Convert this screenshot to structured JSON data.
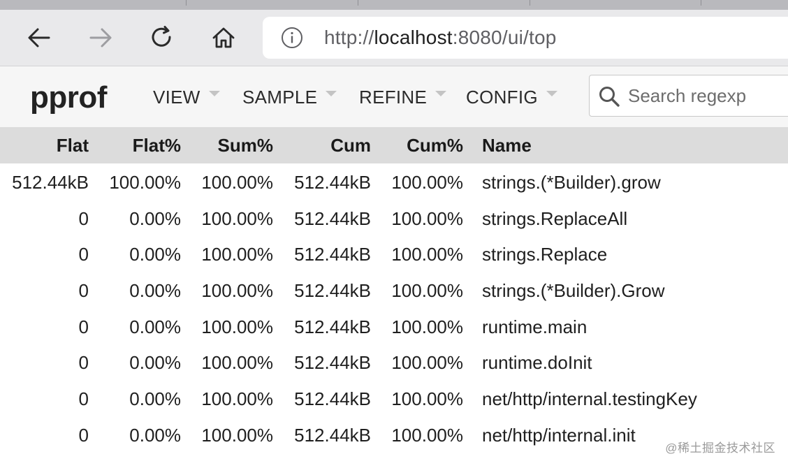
{
  "browser": {
    "url_scheme": "http://",
    "url_host": "localhost",
    "url_rest": ":8080/ui/top"
  },
  "app": {
    "title": "pprof",
    "menus": [
      {
        "label": "VIEW"
      },
      {
        "label": "SAMPLE"
      },
      {
        "label": "REFINE"
      },
      {
        "label": "CONFIG"
      }
    ],
    "search": {
      "placeholder": "Search regexp",
      "value": ""
    }
  },
  "table": {
    "columns": [
      "Flat",
      "Flat%",
      "Sum%",
      "Cum",
      "Cum%",
      "Name"
    ],
    "rows": [
      {
        "flat": "512.44kB",
        "flat_pct": "100.00%",
        "sum_pct": "100.00%",
        "cum": "512.44kB",
        "cum_pct": "100.00%",
        "name": "strings.(*Builder).grow"
      },
      {
        "flat": "0",
        "flat_pct": "0.00%",
        "sum_pct": "100.00%",
        "cum": "512.44kB",
        "cum_pct": "100.00%",
        "name": "strings.ReplaceAll"
      },
      {
        "flat": "0",
        "flat_pct": "0.00%",
        "sum_pct": "100.00%",
        "cum": "512.44kB",
        "cum_pct": "100.00%",
        "name": "strings.Replace"
      },
      {
        "flat": "0",
        "flat_pct": "0.00%",
        "sum_pct": "100.00%",
        "cum": "512.44kB",
        "cum_pct": "100.00%",
        "name": "strings.(*Builder).Grow"
      },
      {
        "flat": "0",
        "flat_pct": "0.00%",
        "sum_pct": "100.00%",
        "cum": "512.44kB",
        "cum_pct": "100.00%",
        "name": "runtime.main"
      },
      {
        "flat": "0",
        "flat_pct": "0.00%",
        "sum_pct": "100.00%",
        "cum": "512.44kB",
        "cum_pct": "100.00%",
        "name": "runtime.doInit"
      },
      {
        "flat": "0",
        "flat_pct": "0.00%",
        "sum_pct": "100.00%",
        "cum": "512.44kB",
        "cum_pct": "100.00%",
        "name": "net/http/internal.testingKey"
      },
      {
        "flat": "0",
        "flat_pct": "0.00%",
        "sum_pct": "100.00%",
        "cum": "512.44kB",
        "cum_pct": "100.00%",
        "name": "net/http/internal.init"
      }
    ]
  },
  "watermark": "@稀土掘金技术社区"
}
